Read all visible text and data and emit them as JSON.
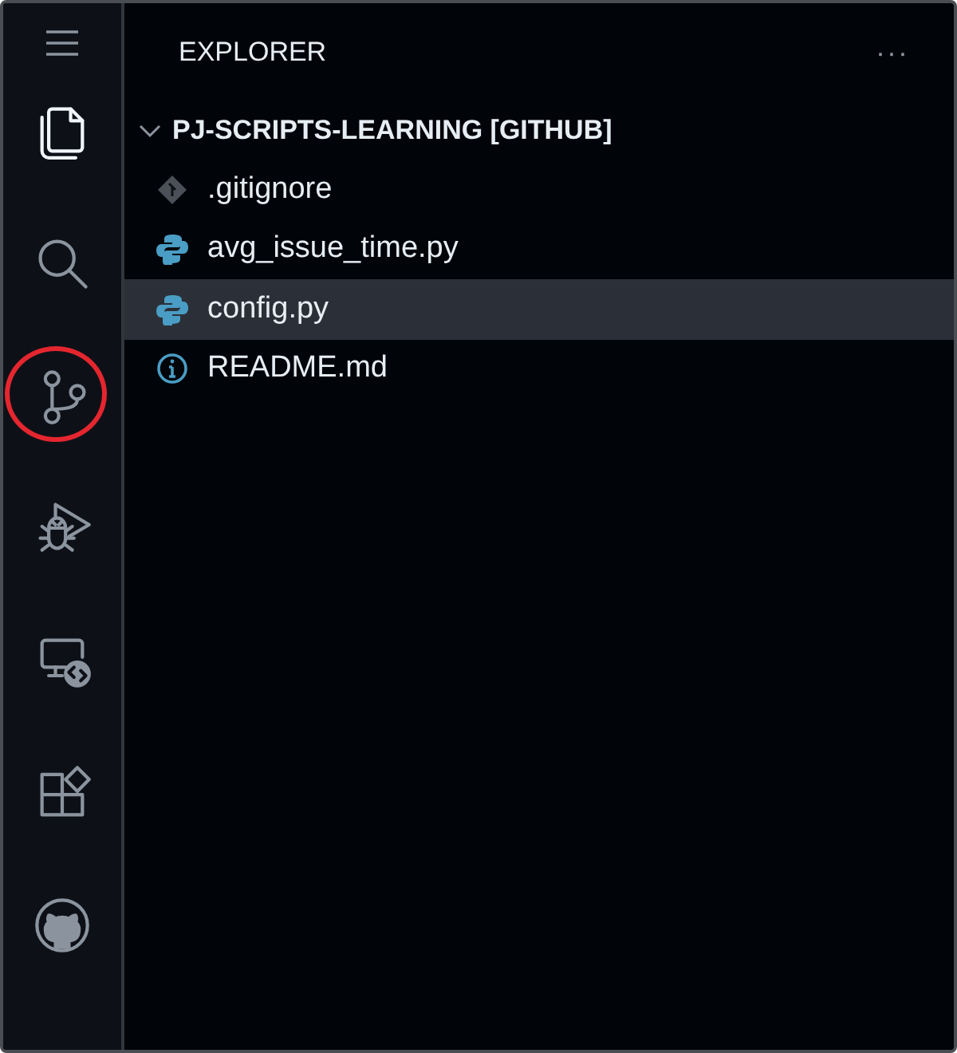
{
  "activity_bar": {
    "items": [
      {
        "kind": "files",
        "selected": true,
        "circled": false
      },
      {
        "kind": "search",
        "selected": false,
        "circled": false
      },
      {
        "kind": "source-control",
        "selected": false,
        "circled": true
      },
      {
        "kind": "run-debug",
        "selected": false,
        "circled": false
      },
      {
        "kind": "remote",
        "selected": false,
        "circled": false
      },
      {
        "kind": "extensions",
        "selected": false,
        "circled": false
      },
      {
        "kind": "github",
        "selected": false,
        "circled": false
      }
    ]
  },
  "explorer": {
    "title": "EXPLORER",
    "more": "···",
    "folder": {
      "name": "PJ-SCRIPTS-LEARNING [GITHUB]",
      "expanded": true,
      "children": [
        {
          "name": ".gitignore",
          "kind": "git",
          "selected": false
        },
        {
          "name": "avg_issue_time.py",
          "kind": "python",
          "selected": false
        },
        {
          "name": "config.py",
          "kind": "python",
          "selected": true
        },
        {
          "name": "README.md",
          "kind": "info",
          "selected": false
        }
      ]
    }
  }
}
